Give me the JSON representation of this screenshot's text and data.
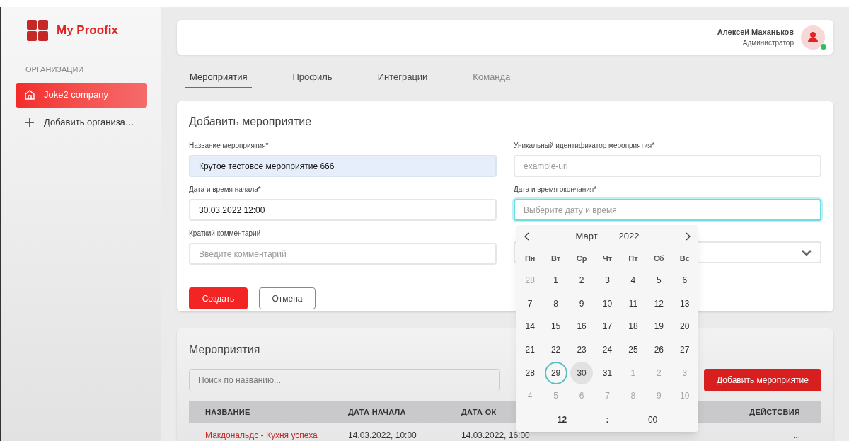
{
  "sidebar": {
    "logo": "My Proofix",
    "section": "ОРГАНИЗАЦИИ",
    "items": [
      {
        "label": "Joke2 company",
        "kind": "org",
        "selected": true
      },
      {
        "label": "Добавить организа…",
        "kind": "add",
        "selected": false
      }
    ]
  },
  "header": {
    "user_name": "Алексей Маханьков",
    "user_role": "Администратор",
    "online": true
  },
  "tabs": [
    {
      "label": "Мероприятия",
      "selected": true
    },
    {
      "label": "Профиль",
      "selected": false
    },
    {
      "label": "Интеграции",
      "selected": false
    },
    {
      "label": "Команда",
      "selected": false
    }
  ],
  "form": {
    "title": "Добавить мероприятие",
    "fields": [
      {
        "label": "Название мероприятия*",
        "value": "Крутое тестовое мероприятие 666",
        "autofilled": true,
        "focused": false
      },
      {
        "label": "Уникальный идентификатор мероприятия*",
        "placeholder": "example-url",
        "autofilled": false,
        "focused": false
      },
      {
        "label": "Дата и время начала*",
        "value": "30.03.2022 12:00",
        "autofilled": false,
        "focused": false
      },
      {
        "label": "Дата и время окончания*",
        "placeholder": "Выберите дату и время",
        "autofilled": false,
        "focused": true
      },
      {
        "label": "Краткий комментарий",
        "placeholder": "Введите комментарий",
        "autofilled": false,
        "focused": false
      },
      {
        "kind": "select",
        "autofilled": false,
        "focused": false
      }
    ],
    "buttons": [
      {
        "label": "Создать",
        "kind": "primary"
      },
      {
        "label": "Отмена",
        "kind": "secondary"
      }
    ]
  },
  "calendar": {
    "month": "Март",
    "year": "2022",
    "weekdays": [
      "Пн",
      "Вт",
      "Ср",
      "Чт",
      "Пт",
      "Сб",
      "Вс"
    ],
    "days": [
      {
        "label": "28",
        "muted": true,
        "selected": false,
        "hovered": false
      },
      {
        "label": "1",
        "muted": false,
        "selected": false,
        "hovered": false
      },
      {
        "label": "2",
        "muted": false,
        "selected": false,
        "hovered": false
      },
      {
        "label": "3",
        "muted": false,
        "selected": false,
        "hovered": false
      },
      {
        "label": "4",
        "muted": false,
        "selected": false,
        "hovered": false
      },
      {
        "label": "5",
        "muted": false,
        "selected": false,
        "hovered": false
      },
      {
        "label": "6",
        "muted": false,
        "selected": false,
        "hovered": false
      },
      {
        "label": "7",
        "muted": false,
        "selected": false,
        "hovered": false
      },
      {
        "label": "8",
        "muted": false,
        "selected": false,
        "hovered": false
      },
      {
        "label": "9",
        "muted": false,
        "selected": false,
        "hovered": false
      },
      {
        "label": "10",
        "muted": false,
        "selected": false,
        "hovered": false
      },
      {
        "label": "11",
        "muted": false,
        "selected": false,
        "hovered": false
      },
      {
        "label": "12",
        "muted": false,
        "selected": false,
        "hovered": false
      },
      {
        "label": "13",
        "muted": false,
        "selected": false,
        "hovered": false
      },
      {
        "label": "14",
        "muted": false,
        "selected": false,
        "hovered": false
      },
      {
        "label": "15",
        "muted": false,
        "selected": false,
        "hovered": false
      },
      {
        "label": "16",
        "muted": false,
        "selected": false,
        "hovered": false
      },
      {
        "label": "17",
        "muted": false,
        "selected": false,
        "hovered": false
      },
      {
        "label": "18",
        "muted": false,
        "selected": false,
        "hovered": false
      },
      {
        "label": "19",
        "muted": false,
        "selected": false,
        "hovered": false
      },
      {
        "label": "20",
        "muted": false,
        "selected": false,
        "hovered": false
      },
      {
        "label": "21",
        "muted": false,
        "selected": false,
        "hovered": false
      },
      {
        "label": "22",
        "muted": false,
        "selected": false,
        "hovered": false
      },
      {
        "label": "23",
        "muted": false,
        "selected": false,
        "hovered": false
      },
      {
        "label": "24",
        "muted": false,
        "selected": false,
        "hovered": false
      },
      {
        "label": "25",
        "muted": false,
        "selected": false,
        "hovered": false
      },
      {
        "label": "26",
        "muted": false,
        "selected": false,
        "hovered": false
      },
      {
        "label": "27",
        "muted": false,
        "selected": false,
        "hovered": false
      },
      {
        "label": "28",
        "muted": false,
        "selected": false,
        "hovered": false
      },
      {
        "label": "29",
        "muted": false,
        "selected": true,
        "hovered": false
      },
      {
        "label": "30",
        "muted": false,
        "selected": false,
        "hovered": true
      },
      {
        "label": "31",
        "muted": false,
        "selected": false,
        "hovered": false
      },
      {
        "label": "1",
        "muted": true,
        "selected": false,
        "hovered": false
      },
      {
        "label": "2",
        "muted": true,
        "selected": false,
        "hovered": false
      },
      {
        "label": "3",
        "muted": true,
        "selected": false,
        "hovered": false
      },
      {
        "label": "4",
        "muted": true,
        "selected": false,
        "hovered": false
      },
      {
        "label": "5",
        "muted": true,
        "selected": false,
        "hovered": false
      },
      {
        "label": "6",
        "muted": true,
        "selected": false,
        "hovered": false
      },
      {
        "label": "7",
        "muted": true,
        "selected": false,
        "hovered": false
      },
      {
        "label": "8",
        "muted": true,
        "selected": false,
        "hovered": false
      },
      {
        "label": "9",
        "muted": true,
        "selected": false,
        "hovered": false
      },
      {
        "label": "10",
        "muted": true,
        "selected": false,
        "hovered": false
      }
    ],
    "hours": "12",
    "separator": ":",
    "minutes": "00"
  },
  "events": {
    "title": "Мероприятия",
    "search_placeholder": "Поиск по названию...",
    "add_button": "Добавить мероприятие",
    "table": {
      "columns": [
        "НАЗВАНИЕ",
        "ДАТА НАЧАЛА",
        "ДАТА ОК",
        "ДЕЙСТСВИЯ"
      ],
      "rows": [
        {
          "name": "Макдональдс - Кухня успеха",
          "start": "14.03.2022, 10:00",
          "end": "14.03.2022, 16:00",
          "actions": "..."
        }
      ]
    }
  }
}
